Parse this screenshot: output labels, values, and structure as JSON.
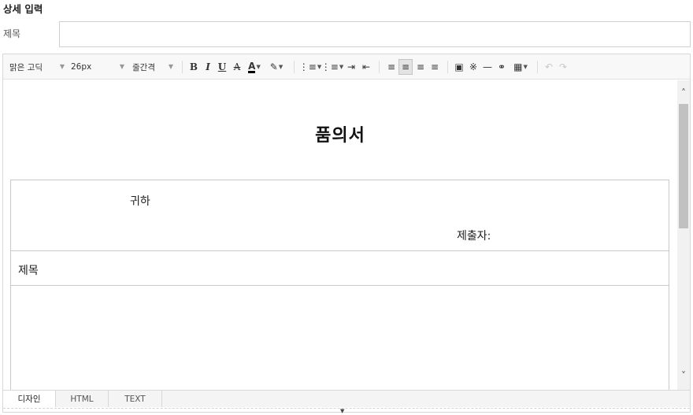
{
  "section": {
    "title": "상세 입력"
  },
  "subject_field": {
    "label": "제목",
    "value": "",
    "placeholder": ""
  },
  "toolbar": {
    "font_family": "맑은 고딕",
    "font_size": "26px",
    "line_height": "줄간격",
    "bold": "B",
    "italic": "I",
    "underline": "U",
    "strike": "A",
    "font_color": "A",
    "bg_color": "✎",
    "ordered_list": "⋮≡",
    "unordered_list": "⋮≡",
    "indent": "⇥",
    "outdent": "⇤",
    "align_left": "≡",
    "align_center": "≡",
    "align_right": "≡",
    "align_justify": "≡",
    "image": "▣",
    "special_char": "※",
    "hr": "—",
    "link": "⚭",
    "table": "▦",
    "undo": "↶",
    "redo": "↷"
  },
  "document": {
    "title": "품의서",
    "recipient": "귀하",
    "submitter": "제출자:",
    "subject": "제목"
  },
  "tabs": [
    {
      "label": "디자인"
    },
    {
      "label": "HTML"
    },
    {
      "label": "TEXT"
    }
  ],
  "scroll": {
    "up": "˄",
    "down": "˅"
  },
  "resize": {
    "handle": "▼"
  }
}
